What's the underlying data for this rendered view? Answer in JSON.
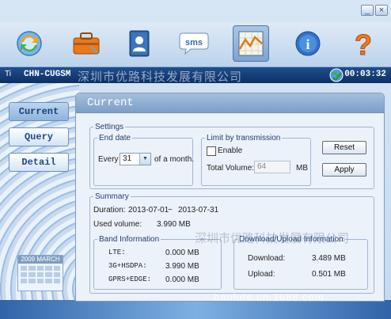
{
  "window": {
    "minimize_label": "_",
    "close_label": "×"
  },
  "toolbar": {
    "items": [
      {
        "name": "sync-icon"
      },
      {
        "name": "toolbox-icon"
      },
      {
        "name": "contacts-icon"
      },
      {
        "name": "sms-icon",
        "label": "sms"
      },
      {
        "name": "traffic-chart-icon",
        "selected": true
      },
      {
        "name": "info-icon",
        "label": "i"
      },
      {
        "name": "help-icon",
        "label": "?"
      }
    ]
  },
  "status": {
    "signal": "Ti",
    "carrier": "CHN-CUGSM",
    "watermark": "深圳市优路科技发展有限公司",
    "clock": "00:03:32"
  },
  "nav": {
    "current": "Current",
    "query": "Query",
    "detail": "Detail",
    "calendar_caption": "2009 MARCH"
  },
  "panel": {
    "title": "Current",
    "settings": {
      "legend": "Settings",
      "end_date": {
        "legend": "End date",
        "every_label": "Every",
        "day_value": "31",
        "suffix": "of a month."
      },
      "limit": {
        "legend": "Limit by transmission",
        "enable_label": "Enable",
        "total_volume_label": "Total Volume:",
        "total_volume_value": "64",
        "unit": "MB"
      },
      "reset_label": "Reset",
      "apply_label": "Apply"
    },
    "summary": {
      "legend": "Summary",
      "duration_label": "Duration:",
      "duration_start": "2013-07-01",
      "duration_sep": "~",
      "duration_end": "2013-07-31",
      "used_volume_label": "Used volume:",
      "used_volume_value": "3.990 MB",
      "band": {
        "legend": "Band Information",
        "rows": [
          {
            "label": "LTE:",
            "value": "0.000 MB"
          },
          {
            "label": "3G+HSDPA:",
            "value": "3.990 MB"
          },
          {
            "label": "GPRS+EDGE:",
            "value": "0.000 MB"
          }
        ]
      },
      "download_upload": {
        "legend": "Download/Upload Information",
        "download_label": "Download:",
        "download_value": "3.489 MB",
        "upload_label": "Upload:",
        "upload_value": "0.501 MB"
      }
    },
    "watermark": "深圳市优路科技发展有限公司"
  },
  "footer_watermark": "baolute.cn.1688.com",
  "colors": {
    "accent": "#1f4f8f",
    "panel_header": "#8eaed4"
  }
}
